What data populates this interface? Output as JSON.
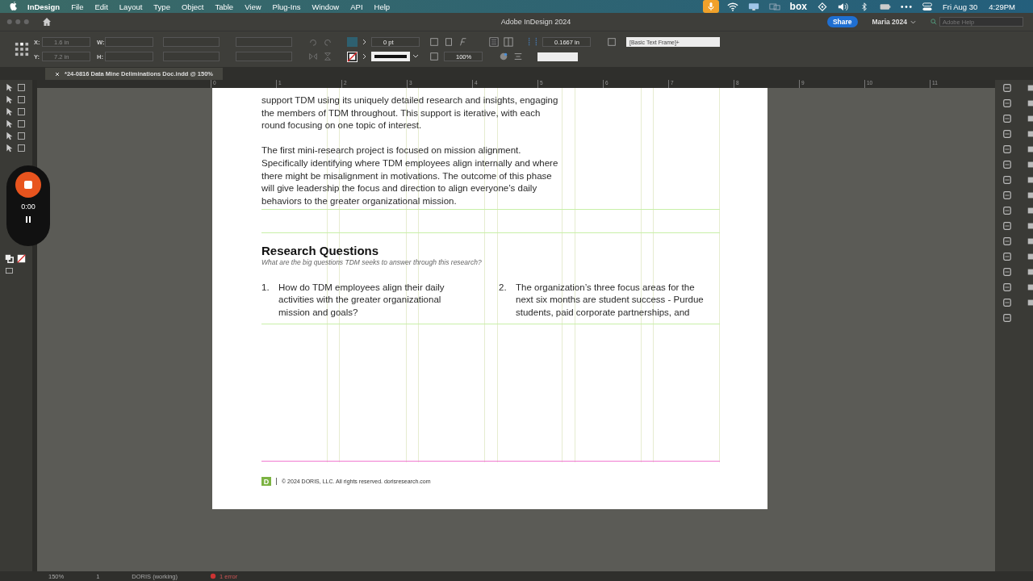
{
  "menubar": {
    "app": "InDesign",
    "menus": [
      "File",
      "Edit",
      "Layout",
      "Type",
      "Object",
      "Table",
      "View",
      "Plug-Ins",
      "Window",
      "API",
      "Help"
    ],
    "box_label": "box",
    "date": "Fri Aug 30",
    "time": "4:29PM"
  },
  "window": {
    "title": "Adobe InDesign 2024",
    "share": "Share",
    "user": "Maria 2024",
    "help_placeholder": "Adobe Help"
  },
  "control_bar": {
    "x_label": "X:",
    "x_value": "1.6 in",
    "y_label": "Y:",
    "y_value": "7.2 in",
    "w_label": "W:",
    "h_label": "H:",
    "stroke_weight": "0 pt",
    "scale": "100%",
    "gutter": "0.1667 in",
    "object_style": "[Basic Text Frame]+"
  },
  "document_tab": {
    "title": "*24-0816 Data Mine Deliminations Doc.indd @ 150%"
  },
  "ruler": [
    "0",
    "1",
    "2",
    "3",
    "4",
    "5",
    "6",
    "7",
    "8",
    "9",
    "10",
    "11"
  ],
  "page": {
    "paragraphs": [
      {
        "lines": [
          "support TDM using its uniquely detailed research and insights, engaging",
          "the members of TDM throughout. This support is iterative, with each",
          "round focusing on one topic of interest."
        ]
      },
      {
        "lines": [
          "The first mini-research project is focused on mission alignment.",
          "Specifically identifying where TDM employees align internally and where",
          "there might be misalignment in motivations. The outcome of this phase",
          "will give leadership the focus and direction to align everyone’s daily",
          "behaviors to the greater organizational mission."
        ]
      }
    ],
    "heading": "Research Questions",
    "subheading": "What are the big questions TDM seeks to answer through this research?",
    "questions": [
      {
        "number": "1.",
        "lines": [
          "How do TDM employees align their daily",
          "activities with the greater organizational",
          "mission and goals?"
        ]
      },
      {
        "number": "2.",
        "lines": [
          "The organization’s three focus areas for the",
          "next six months are student success - Purdue",
          "students, paid corporate partnerships, and"
        ]
      }
    ],
    "footer": {
      "logo": "D",
      "text": "© 2024 DORIS, LLC. All rights reserved.  dorisresearch.com"
    }
  },
  "recorder": {
    "time": "0:00"
  },
  "status_bar": {
    "zoom": "150%",
    "page": "1",
    "profile": "DORIS (working)",
    "errors": "1 error"
  }
}
